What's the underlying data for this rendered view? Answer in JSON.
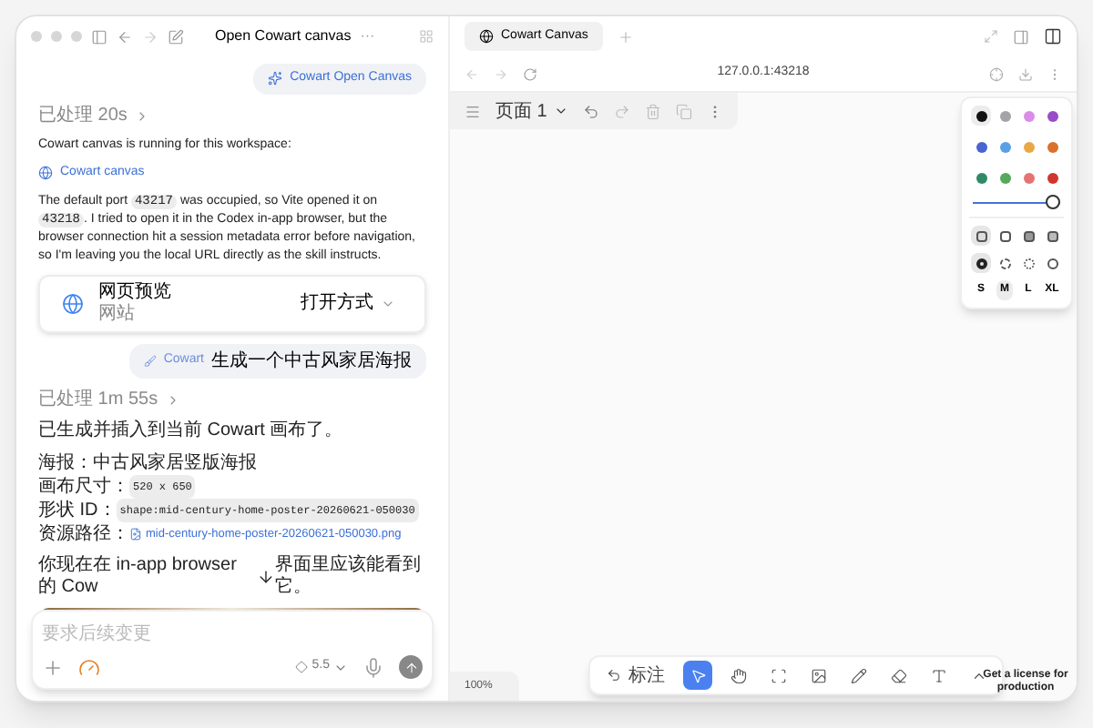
{
  "window": {
    "title": "Open Cowart canvas",
    "more": "···"
  },
  "chat": {
    "chip": "Cowart Open Canvas",
    "turns": [
      {
        "processed": "已处理 20s",
        "intro": "Cowart canvas is running for this workspace:",
        "link": "Cowart canvas",
        "paragraph": [
          {
            "kind": "text",
            "text": "The default port "
          },
          {
            "kind": "code",
            "text": "43217"
          },
          {
            "kind": "text",
            "text": " was occupied, so Vite opened it on "
          },
          {
            "kind": "code",
            "text": "43218"
          },
          {
            "kind": "text",
            "text": ". I tried to open it in the Codex in-app browser, but the browser connection hit a session metadata error before navigation, so I'm leaving you the local URL directly as the skill instructs."
          }
        ],
        "card": {
          "title": "网页预览",
          "subtitle": "网站",
          "action": "打开方式"
        }
      },
      {
        "user_tag": "Cowart",
        "user_text": "生成一个中古风家居海报"
      },
      {
        "processed": "已处理 1m 55s",
        "intro": "已生成并插入到当前 Cowart 画布了。",
        "fields": [
          {
            "kind": "text",
            "label": "海报：",
            "value": "中古风家居竖版海报"
          },
          {
            "kind": "code",
            "label": "画布尺寸：",
            "value": "520 x 650"
          },
          {
            "kind": "code",
            "label": "形状 ID：",
            "value": "shape:mid-century-home-poster-20260621-050030"
          },
          {
            "kind": "link",
            "label": "资源路径：",
            "value": "mid-century-home-poster-20260621-050030.png"
          }
        ],
        "closing": [
          "你现在在 in-app browser 的 Cow",
          "界面里应该能看到它。"
        ]
      }
    ],
    "composer": {
      "placeholder": "要求后续变更",
      "model": "5.5"
    }
  },
  "browser": {
    "tab": "Cowart Canvas",
    "url": "127.0.0.1:43218",
    "page": "页面 1",
    "zoom": "100%",
    "annotate": "标注",
    "license": "Get a license for production",
    "tools": [
      {
        "kind": "select",
        "selected": true
      },
      {
        "kind": "hand",
        "selected": false
      },
      {
        "kind": "frame",
        "selected": false
      },
      {
        "kind": "image",
        "selected": false
      },
      {
        "kind": "pencil",
        "selected": false
      },
      {
        "kind": "eraser",
        "selected": false
      },
      {
        "kind": "text",
        "selected": false
      },
      {
        "kind": "more",
        "selected": false
      }
    ],
    "style_panel": {
      "colors": [
        {
          "color": "#111111",
          "selected": true
        },
        {
          "color": "#a3a3a8",
          "selected": false
        },
        {
          "color": "#d98ce8",
          "selected": false
        },
        {
          "color": "#9a4bc6",
          "selected": false
        },
        {
          "color": "#4a63d3",
          "selected": false
        },
        {
          "color": "#5aa0e8",
          "selected": false
        },
        {
          "color": "#e8a844",
          "selected": false
        },
        {
          "color": "#d9712e",
          "selected": false
        },
        {
          "color": "#2e8b66",
          "selected": false
        },
        {
          "color": "#56a85a",
          "selected": false
        },
        {
          "color": "#e57373",
          "selected": false
        },
        {
          "color": "#d0362f",
          "selected": false
        }
      ],
      "opacity": {
        "level": 1
      },
      "fills": [
        {
          "selected": true
        },
        {
          "selected": false
        },
        {
          "selected": false
        },
        {
          "selected": false
        }
      ],
      "strokes": [
        {
          "selected": true
        },
        {
          "selected": false
        },
        {
          "selected": false
        },
        {
          "selected": false
        }
      ],
      "sizes": [
        {
          "label": "S",
          "selected": false
        },
        {
          "label": "M",
          "selected": true
        },
        {
          "label": "L",
          "selected": false
        },
        {
          "label": "XL",
          "selected": false
        }
      ]
    }
  }
}
